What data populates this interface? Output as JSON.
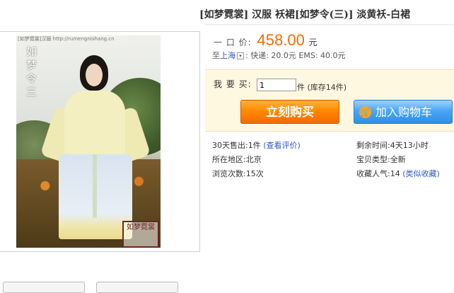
{
  "item": {
    "title": "[如梦霓裳] 汉服 袄裙[如梦令(三)] 淡黄袄-白裙"
  },
  "image": {
    "vertical_text": "如梦令三",
    "watermark": "[如梦霓裳]汉服  http://rumengnishang.cn",
    "seal_text": "如梦霓裳"
  },
  "price": {
    "label": "一 口 价:",
    "value": "458.00",
    "unit": "元"
  },
  "shipping": {
    "to": "至",
    "location": "上海",
    "express": ": 快递: 20.0元  EMS: 40.0元"
  },
  "buy": {
    "qty_label": "我 要 买:",
    "qty_value": "1",
    "qty_suffix": "件 (库存14件)",
    "buy_now_label": "立刻购买",
    "add_cart_label": "加入购物车"
  },
  "stats": {
    "sold_label": "30天售出:1件",
    "review_link": "(查看评价)",
    "time_left": "剩余时间:4天13小时",
    "region": "所在地区:北京",
    "type": "宝贝类型:全新",
    "views": "浏览次数:15次",
    "favorites": "收藏人气:14",
    "fav_link": "(类似收藏)"
  }
}
